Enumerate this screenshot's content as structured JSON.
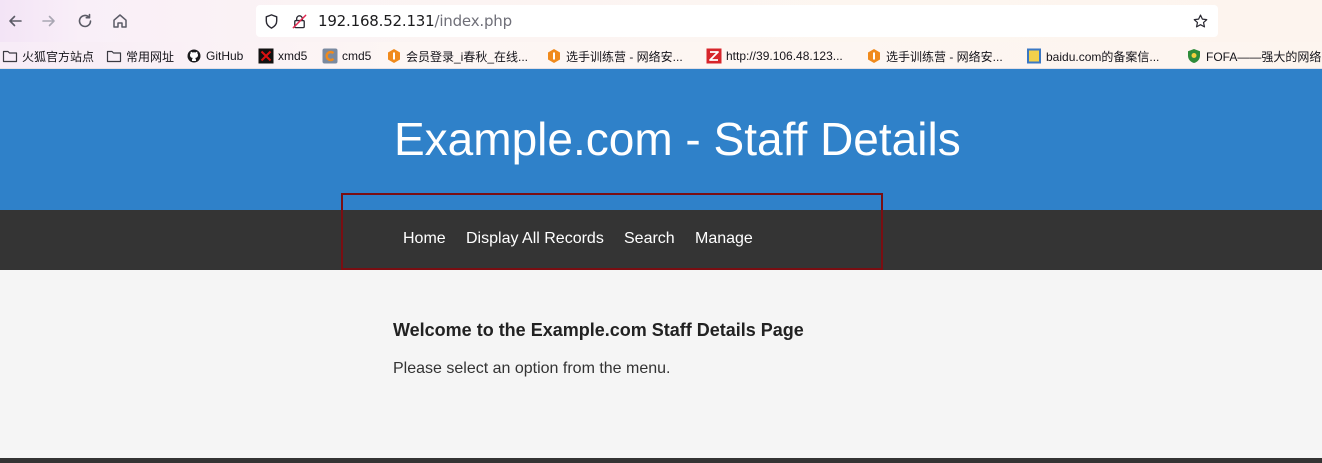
{
  "browser": {
    "url_host": "192.168.52.131",
    "url_path": "/index.php",
    "icons": [
      "back-icon",
      "forward-icon",
      "reload-icon",
      "home-icon",
      "shield-icon",
      "insecure-lock-icon",
      "bookmark-star-icon"
    ],
    "bookmarks": [
      {
        "label": "火狐官方站点",
        "icon": "folder-icon"
      },
      {
        "label": "常用网址",
        "icon": "folder-icon"
      },
      {
        "label": "GitHub",
        "icon": "github-icon"
      },
      {
        "label": "xmd5",
        "icon": "xmd5-icon"
      },
      {
        "label": "cmd5",
        "icon": "cmd5-icon"
      },
      {
        "label": "会员登录_i春秋_在线...",
        "icon": "ichunqiu-icon"
      },
      {
        "label": "选手训练营 - 网络安...",
        "icon": "ichunqiu-icon"
      },
      {
        "label": "http://39.106.48.123...",
        "icon": "z-icon"
      },
      {
        "label": "选手训练营 - 网络安...",
        "icon": "ichunqiu-icon"
      },
      {
        "label": "baidu.com的备案信...",
        "icon": "beian-icon"
      },
      {
        "label": "FOFA——强大的网络",
        "icon": "fofa-icon"
      }
    ]
  },
  "page": {
    "title": "Example.com - Staff Details",
    "nav": [
      {
        "label": "Home"
      },
      {
        "label": "Display All Records"
      },
      {
        "label": "Search"
      },
      {
        "label": "Manage"
      }
    ],
    "welcome_heading": "Welcome to the Example.com Staff Details Page",
    "intro_text": "Please select an option from the menu."
  },
  "colors": {
    "header_bg": "#2f81c9",
    "nav_bg": "#343434",
    "highlight_border": "#7a0e12",
    "content_bg": "#f5f5f5"
  }
}
